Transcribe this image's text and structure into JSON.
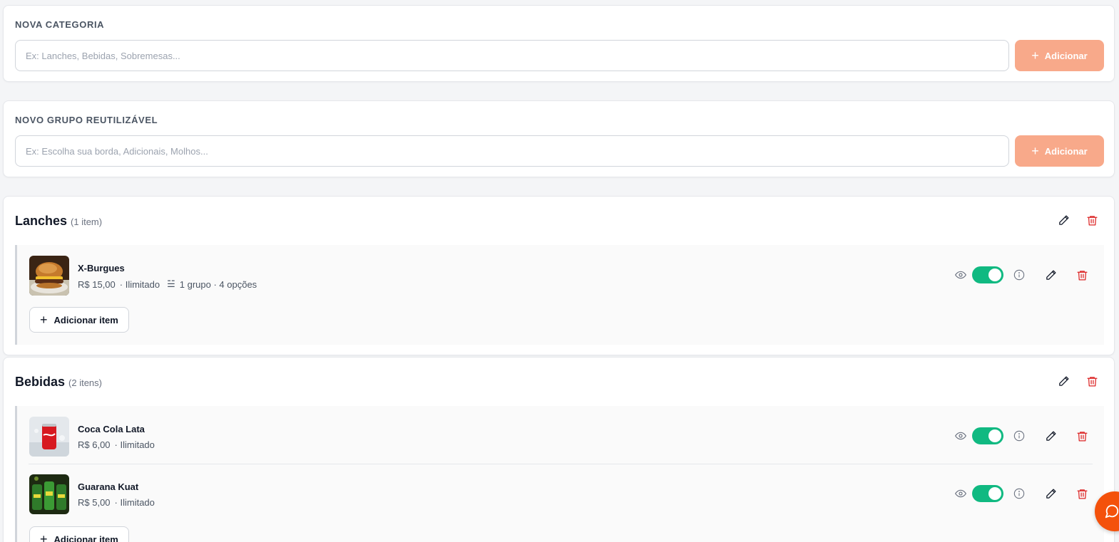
{
  "new_category": {
    "label": "NOVA CATEGORIA",
    "placeholder": "Ex: Lanches, Bebidas, Sobremesas...",
    "value": "",
    "button_label": "Adicionar"
  },
  "new_group": {
    "label": "NOVO GRUPO REUTILIZÁVEL",
    "placeholder": "Ex: Escolha sua borda, Adicionais, Molhos...",
    "value": "",
    "button_label": "Adicionar"
  },
  "categories": [
    {
      "title": "Lanches",
      "count": "(1 item)",
      "items": [
        {
          "name": "X-Burgues",
          "price": "R$ 15,00",
          "stock": "· Ilimitado",
          "groups": "1 grupo · 4 opções",
          "visible": true,
          "image_icon": "burger-photo"
        }
      ],
      "add_item_label": "Adicionar item"
    },
    {
      "title": "Bebidas",
      "count": "(2 itens)",
      "items": [
        {
          "name": "Coca Cola Lata",
          "price": "R$ 6,00",
          "stock": "· Ilimitado",
          "visible": true,
          "image_icon": "coca-cola-can-photo"
        },
        {
          "name": "Guarana Kuat",
          "price": "R$ 5,00",
          "stock": "· Ilimitado",
          "visible": true,
          "image_icon": "kuat-cans-photo"
        }
      ],
      "add_item_label": "Adicionar item"
    }
  ],
  "colors": {
    "accent_disabled": "#f8a98a",
    "toggle_on": "#10b981",
    "delete": "#dc2626",
    "chat_fab": "#f4510b"
  },
  "icons": {
    "add": "plus-icon",
    "edit": "pencil-icon",
    "delete": "trash-icon",
    "visibility": "eye-icon",
    "info": "info-icon",
    "groups": "sliders-icon",
    "chat": "chat-bubble-icon"
  }
}
